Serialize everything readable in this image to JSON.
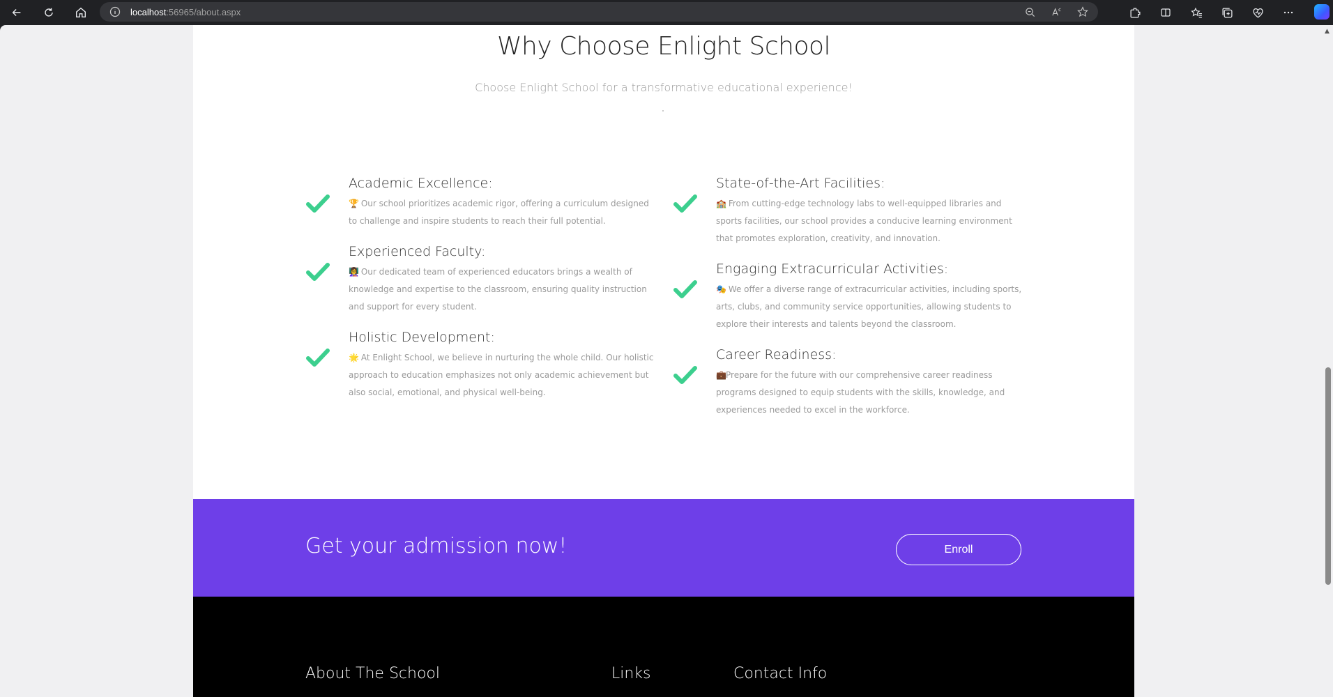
{
  "browser": {
    "url_host": "localhost",
    "url_rest": ":56965/about.aspx"
  },
  "why": {
    "title": "Why Choose Enlight School",
    "subtitle": "Choose Enlight School for a transformative educational experience!"
  },
  "features": [
    {
      "title": "Academic Excellence:",
      "emoji": "🏆",
      "text": " Our school prioritizes academic rigor, offering a curriculum designed to challenge and inspire students to reach their full potential."
    },
    {
      "title": "Experienced Faculty:",
      "emoji": "👩‍🏫",
      "text": " Our dedicated team of experienced educators brings a wealth of knowledge and expertise to the classroom, ensuring quality instruction and support for every student."
    },
    {
      "title": "Holistic Development:",
      "emoji": "🌟",
      "text": " At Enlight School, we believe in nurturing the whole child. Our holistic approach to education emphasizes not only academic achievement but also social, emotional, and physical well-being."
    },
    {
      "title": "State-of-the-Art Facilities:",
      "emoji": "🏫",
      "text": " From cutting-edge technology labs to well-equipped libraries and sports facilities, our school provides a conducive learning environment that promotes exploration, creativity, and innovation."
    },
    {
      "title": "Engaging Extracurricular Activities:",
      "emoji": "🎭",
      "text": " We offer a diverse range of extracurricular activities, including sports, arts, clubs, and community service opportunities, allowing students to explore their interests and talents beyond the classroom."
    },
    {
      "title": "Career Readiness:",
      "emoji": "💼",
      "text": "Prepare for the future with our comprehensive career readiness programs designed to equip students with the skills, knowledge, and experiences needed to excel in the workforce."
    }
  ],
  "admission": {
    "title": "Get your admission now!",
    "button": "Enroll"
  },
  "footer": {
    "about": "About The School",
    "links": "Links",
    "contact": "Contact Info"
  },
  "colors": {
    "accent": "#6e3fe8",
    "check": "#3ccf8e"
  }
}
